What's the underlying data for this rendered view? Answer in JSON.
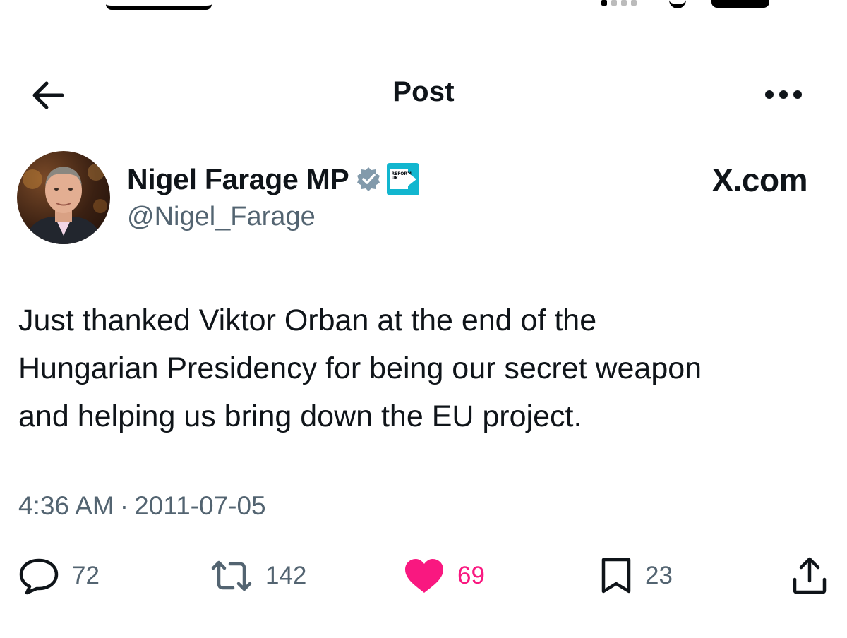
{
  "header": {
    "title": "Post"
  },
  "author": {
    "name": "Nigel Farage MP",
    "handle": "@Nigel_Farage",
    "affiliation_badge_text": "REFORM UK"
  },
  "watermark": "X.com",
  "post": {
    "text": "Just thanked Viktor Orban at the end of the\nHungarian Presidency for being our secret weapon\nand helping us bring down the EU project.",
    "time": "4:36 AM",
    "separator": "·",
    "date": "2011-07-05"
  },
  "actions": {
    "replies": "72",
    "reposts": "142",
    "likes": "69",
    "bookmarks": "23"
  },
  "colors": {
    "like": "#f91880",
    "muted": "#536471",
    "verified": "#829aab",
    "affiliation": "#12b6cf"
  },
  "icons": [
    "back-arrow-icon",
    "more-icon",
    "verified-icon",
    "reply-icon",
    "repost-icon",
    "like-icon",
    "bookmark-icon",
    "share-icon"
  ]
}
